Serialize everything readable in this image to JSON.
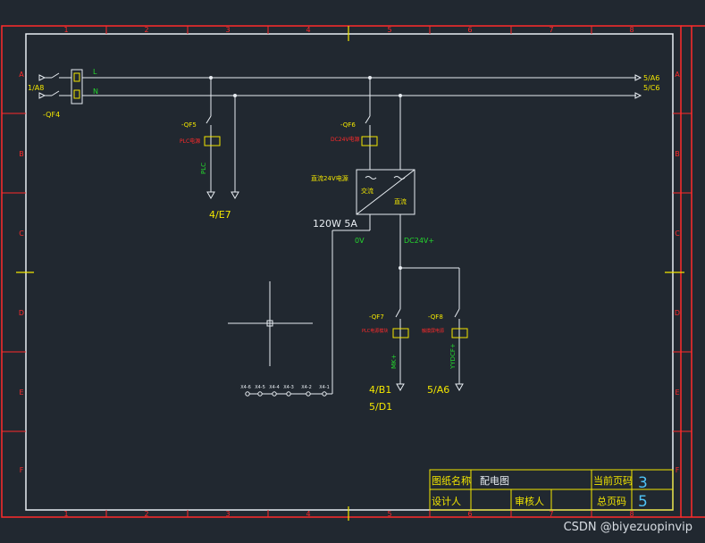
{
  "grid": {
    "cols": [
      "1",
      "2",
      "3",
      "4",
      "5",
      "6",
      "7",
      "8"
    ],
    "rows": [
      "A",
      "B",
      "C",
      "D",
      "E",
      "F"
    ]
  },
  "bus": {
    "line_l": "L",
    "line_n": "N",
    "left_ref": "1/A8",
    "right_ref_l": "5/A6",
    "right_ref_n": "5/C6"
  },
  "breakers": {
    "qf4": "-QF4",
    "qf5": {
      "tag": "-QF5",
      "desc": "PLC电源",
      "wire": "PLC",
      "ref": "4/E7"
    },
    "qf6": {
      "tag": "-QF6",
      "desc": "DC24V电源"
    },
    "qf7": {
      "tag": "-QF7",
      "desc": "PLC电源模块",
      "wire": "MK+",
      "ref1": "4/B1",
      "ref2": "5/D1"
    },
    "qf8": {
      "tag": "-QF8",
      "desc": "触摸屏电源",
      "wire": "YYDCF+",
      "ref": "5/A6"
    }
  },
  "psu": {
    "title": "直流24V电源",
    "ac": "交流",
    "dc": "直流",
    "rating": "120W 5A",
    "neg": "0V",
    "pos": "DC24V+"
  },
  "terminals": [
    "X4-1",
    "X4-2",
    "X4-3",
    "X4-4",
    "X4-5",
    "X4-6"
  ],
  "title_block": {
    "drawing_name_label": "图纸名称",
    "drawing_name": "配电图",
    "current_page_label": "当前页码",
    "current_page": "3",
    "designer_label": "设计人",
    "reviewer_label": "审核人",
    "total_pages_label": "总页码",
    "total_pages": "5"
  },
  "watermark": "CSDN @biyezuopinvip",
  "colors": {
    "frame": "#e8edf2",
    "red": "#ff2a2a",
    "yellow": "#f2e600",
    "green": "#25d62e",
    "white": "#e8edf2"
  }
}
